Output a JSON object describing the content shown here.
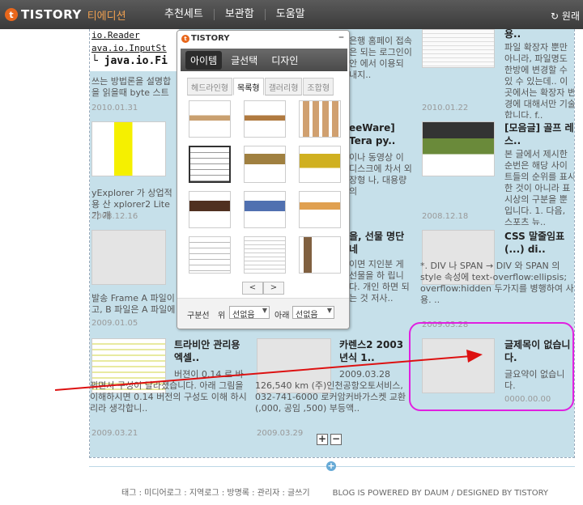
{
  "app": {
    "logo_text": "TISTORY",
    "logo_sub": "티에디션",
    "logo_mark": "t"
  },
  "nav": {
    "items": [
      "추천세트",
      "보관함",
      "도움말"
    ],
    "right": "↻ 원래"
  },
  "posts": [
    {
      "title": "",
      "body": "쓰는 방법론을 설명합 을 읽을때 byte 스트",
      "date": "2010.01.31",
      "code": [
        "io.Reader",
        "ava.io.InputSt",
        "└ java.io.Fi"
      ]
    },
    {
      "title": "",
      "body": "은행 홈페이 접속은 되는 로그인이 안 에서 이용되 내지..",
      "date": ""
    },
    {
      "title": "용..",
      "body": "파일 확장자 뿐만 아니라, 파일명도 한방에 변경할 수 있 수 있는데.. 이곳에서는 확장자 변경에 대해서만 기술합니다. f..",
      "date": "2010.01.22"
    },
    {
      "title": "",
      "body": "yExplorer 가 상업적 용 산 xplorer2 Lite 가 개",
      "date": "2008.12.16"
    },
    {
      "title": "eeWare] Tera py..",
      "body": "이나 동영상 이 디스크에 차서 외장형 나, 대용량의",
      "date": ""
    },
    {
      "title": "[모음글] 골프 레스..",
      "body": "본 글에서 제시한 순번은 해당 사이 트들의 순위를 표시한 것이 아니라 표시상의 구분을 뿐 입니다. 1. 다음, 스포츠 뉴..",
      "date": "2008.12.18"
    },
    {
      "title": "",
      "body": "발송 Frame A 파일이 고, B 파일은 A 파일에",
      "date": "2009.01.05"
    },
    {
      "title": "을, 선물 명단 네",
      "body": "이면 지인분 게 선물을 하 립니다. 개인 하면 되는 것 저사..",
      "date": ""
    },
    {
      "title": "CSS 말줄임표(...) di..",
      "body": "*. DIV 나 SPAN → DIV 와 SPAN 의 style 속성에 text-overflow:ellipsis; overflow:hidden 두가지를 병행하여 사용. ..",
      "date": "2009.03.28"
    },
    {
      "title": "트라비안 관리용 엑셀..",
      "body": "버젼이 0.14 로 바 뀌면서 구성이 달라졌습니다. 아래 그림을 이해하시면 0.14 버전의 구성도 이해 하시리라 생각합니..",
      "date": "2009.03.21"
    },
    {
      "title": "카렌스2 2003 년식 1..",
      "body": "2009.03.28 126,540 km (주)인천공항오토서비스, 032-741-6000 로커암커바가스켓 교환 (,000, 공임 ,500) 부등액..",
      "date": "2009.03.29"
    },
    {
      "title": "글제목이 없습니다.",
      "body": "글요약이 없습니다.",
      "date": "0000.00.00"
    }
  ],
  "panel": {
    "logo_text": "TISTORY",
    "close": "–",
    "tabs": [
      "아이템",
      "글선택",
      "디자인"
    ],
    "subtabs": [
      "헤드라인형",
      "목록형",
      "갤러리형",
      "조합형"
    ],
    "pager": [
      "<",
      ">"
    ],
    "divider_label": "구분선",
    "top_label": "위",
    "top_value": "선없음",
    "bottom_label": "아래",
    "bottom_value": "선없음"
  },
  "zoom": {
    "plus": "+",
    "minus": "−"
  },
  "add": "+",
  "footer": {
    "left": "태그 : 미디어로그 : 지역로그 : 방명록 : 관리자 : 글쓰기",
    "right": "BLOG IS POWERED BY DAUM / DESIGNED BY TISTORY"
  },
  "colors": {
    "canvas": "#c6e0ea",
    "highlight": "#e020e0",
    "arrow": "#dd1111",
    "topbar": "#444444"
  }
}
